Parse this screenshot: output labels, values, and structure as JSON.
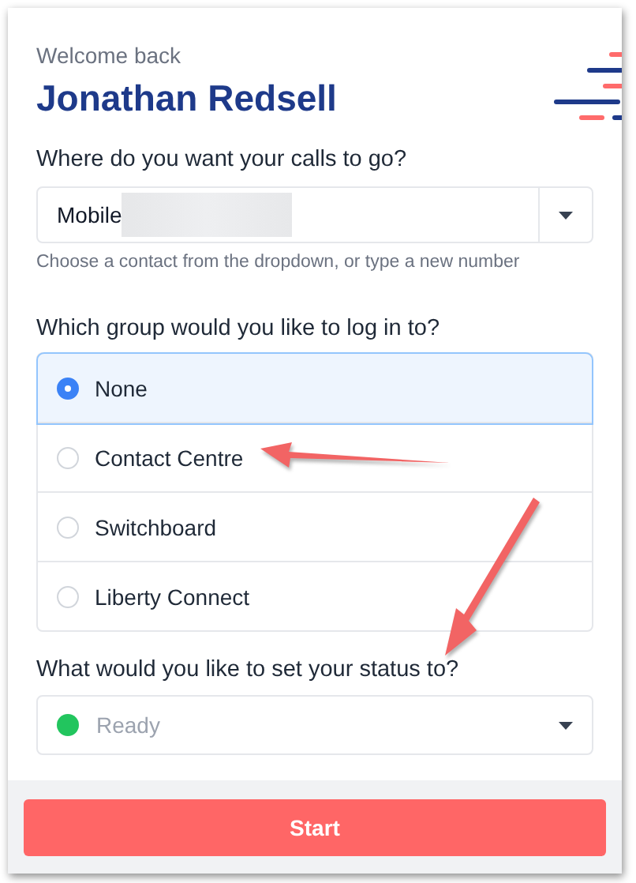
{
  "greeting": "Welcome back",
  "user_name": "Jonathan Redsell",
  "destination": {
    "label": "Where do you want your calls to go?",
    "value": "Mobile",
    "helper": "Choose a contact from the dropdown, or type a new number"
  },
  "group": {
    "label": "Which group would you like to log in to?",
    "options": [
      {
        "label": "None",
        "selected": true
      },
      {
        "label": "Contact Centre",
        "selected": false
      },
      {
        "label": "Switchboard",
        "selected": false
      },
      {
        "label": "Liberty Connect",
        "selected": false
      }
    ]
  },
  "status": {
    "label": "What would you like to set your status to?",
    "value": "Ready",
    "color": "#22c55e"
  },
  "start_button": "Start"
}
